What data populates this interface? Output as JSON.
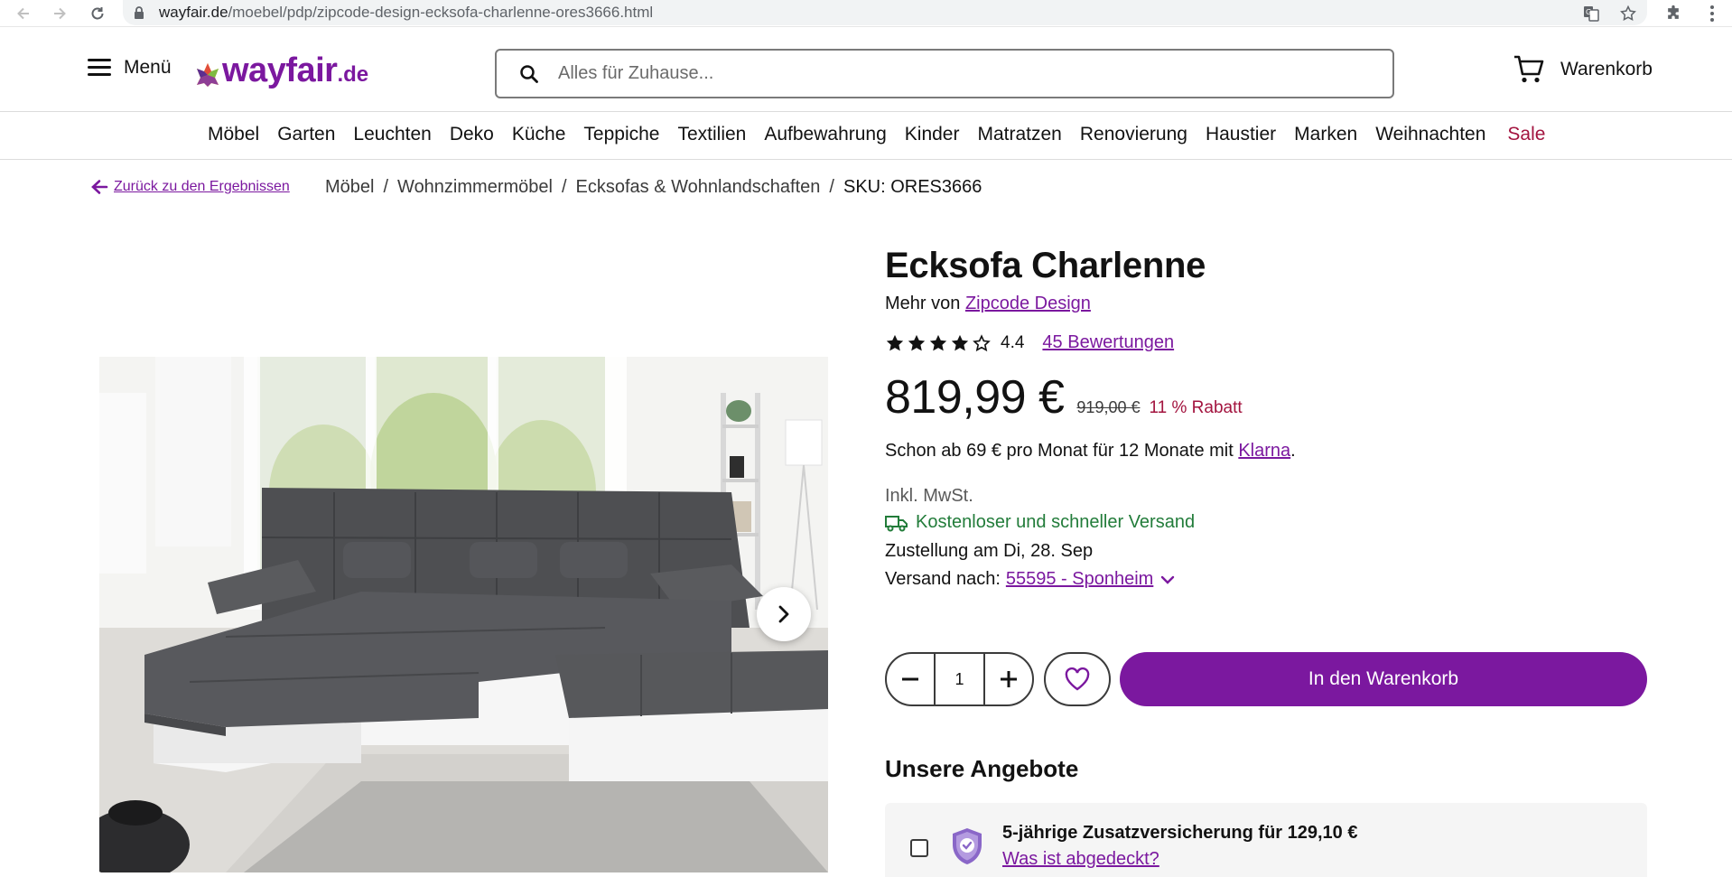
{
  "browser": {
    "url_host": "wayfair.de",
    "url_path": "/moebel/pdp/zipcode-design-ecksofa-charlenne-ores3666.html"
  },
  "header": {
    "menu_label": "Menü",
    "logo_word": "wayfair",
    "logo_tld": ".de",
    "search_placeholder": "Alles für Zuhause...",
    "cart_label": "Warenkorb"
  },
  "categories": [
    "Möbel",
    "Garten",
    "Leuchten",
    "Deko",
    "Küche",
    "Teppiche",
    "Textilien",
    "Aufbewahrung",
    "Kinder",
    "Matratzen",
    "Renovierung",
    "Haustier",
    "Marken",
    "Weihnachten",
    "Sale"
  ],
  "breadcrumb": {
    "back_label": "Zurück zu den Ergebnissen",
    "items": [
      "Möbel",
      "Wohnzimmermöbel",
      "Ecksofas & Wohnlandschaften"
    ],
    "sku": "SKU: ORES3666"
  },
  "product": {
    "title": "Ecksofa Charlenne",
    "brand_prefix": "Mehr von",
    "brand": "Zipcode Design",
    "rating": "4.4",
    "stars_filled": 4,
    "stars_total": 5,
    "reviews": "45 Bewertungen",
    "price": "819,99 €",
    "old_price": "919,00 €",
    "discount": "11 % Rabatt",
    "klarna_prefix": "Schon ab 69 € pro Monat für 12 Monate mit",
    "klarna_link": "Klarna",
    "klarna_suffix": ".",
    "vat": "Inkl. MwSt.",
    "shipping": "Kostenloser und schneller Versand",
    "delivery": "Zustellung am Di, 28. Sep",
    "ship_to_label": "Versand nach:",
    "ship_to_value": "55595 - Sponheim",
    "quantity": "1",
    "add_to_cart": "In den Warenkorb"
  },
  "offers": {
    "title": "Unsere Angebote",
    "warranty_text": "5-jährige Zusatzversicherung für 129,10 €",
    "warranty_link": "Was ist abgedeckt?"
  },
  "colors": {
    "brand_purple": "#7b189f",
    "sale_red": "#a3143f",
    "shipping_green": "#227c3a"
  }
}
